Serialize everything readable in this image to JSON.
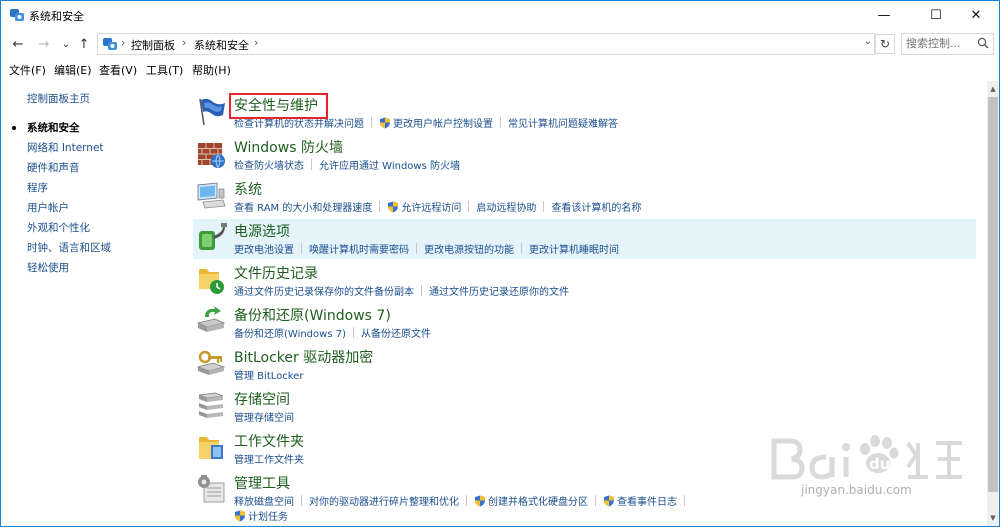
{
  "window": {
    "title": "系统和安全",
    "controls": {
      "minimize": "—",
      "maximize": "☐",
      "close": "✕"
    }
  },
  "nav": {
    "back": "←",
    "forward": "→",
    "recent": "⌄",
    "up": "↑"
  },
  "address": {
    "crumbs": [
      "控制面板",
      "系统和安全"
    ],
    "sep": "›",
    "dropdown": "⌄",
    "refresh": "↻"
  },
  "search": {
    "placeholder": "搜索控制..."
  },
  "menu": [
    "文件(F)",
    "编辑(E)",
    "查看(V)",
    "工具(T)",
    "帮助(H)"
  ],
  "sidebar": {
    "items": [
      {
        "label": "控制面板主页"
      },
      {
        "label": "系统和安全",
        "current": true
      },
      {
        "label": "网络和 Internet"
      },
      {
        "label": "硬件和声音"
      },
      {
        "label": "程序"
      },
      {
        "label": "用户帐户"
      },
      {
        "label": "外观和个性化"
      },
      {
        "label": "时钟、语言和区域"
      },
      {
        "label": "轻松使用"
      }
    ]
  },
  "categories": [
    {
      "title": "安全性与维护",
      "icon": "flag-icon",
      "links": [
        {
          "text": "检查计算机的状态并解决问题"
        },
        {
          "text": "更改用户帐户控制设置",
          "shield": true
        },
        {
          "text": "常见计算机问题疑难解答"
        }
      ]
    },
    {
      "title": "Windows 防火墙",
      "icon": "firewall-icon",
      "links": [
        {
          "text": "检查防火墙状态"
        },
        {
          "text": "允许应用通过 Windows 防火墙"
        }
      ]
    },
    {
      "title": "系统",
      "icon": "computer-icon",
      "links": [
        {
          "text": "查看 RAM 的大小和处理器速度"
        },
        {
          "text": "允许远程访问",
          "shield": true
        },
        {
          "text": "启动远程协助"
        },
        {
          "text": "查看该计算机的名称"
        }
      ]
    },
    {
      "title": "电源选项",
      "icon": "power-icon",
      "highlight": true,
      "links": [
        {
          "text": "更改电池设置"
        },
        {
          "text": "唤醒计算机时需要密码"
        },
        {
          "text": "更改电源按钮的功能"
        },
        {
          "text": "更改计算机睡眠时间"
        }
      ]
    },
    {
      "title": "文件历史记录",
      "icon": "file-history-icon",
      "links": [
        {
          "text": "通过文件历史记录保存你的文件备份副本"
        },
        {
          "text": "通过文件历史记录还原你的文件"
        }
      ]
    },
    {
      "title": "备份和还原(Windows 7)",
      "icon": "backup-icon",
      "links": [
        {
          "text": "备份和还原(Windows 7)"
        },
        {
          "text": "从备份还原文件"
        }
      ]
    },
    {
      "title": "BitLocker 驱动器加密",
      "icon": "bitlocker-icon",
      "links": [
        {
          "text": "管理 BitLocker"
        }
      ]
    },
    {
      "title": "存储空间",
      "icon": "storage-icon",
      "links": [
        {
          "text": "管理存储空间"
        }
      ]
    },
    {
      "title": "工作文件夹",
      "icon": "work-folder-icon",
      "links": [
        {
          "text": "管理工作文件夹"
        }
      ]
    },
    {
      "title": "管理工具",
      "icon": "admin-tools-icon",
      "links": [
        {
          "text": "释放磁盘空间"
        },
        {
          "text": "对你的驱动器进行碎片整理和优化"
        },
        {
          "text": "创建并格式化硬盘分区",
          "shield": true
        },
        {
          "text": "查看事件日志",
          "shield": true
        }
      ],
      "links2": [
        {
          "text": "计划任务",
          "shield": true
        }
      ]
    }
  ],
  "scrollbar": {
    "up": "▲",
    "down": "▼"
  },
  "watermark": {
    "text": "jingyan.baidu.com"
  },
  "colors": {
    "link": "#1c4f8f",
    "category_title": "#1e5e1e",
    "highlight": "#e5f3fb",
    "annotation": "#e8242a",
    "window_border": "#1883d7"
  }
}
